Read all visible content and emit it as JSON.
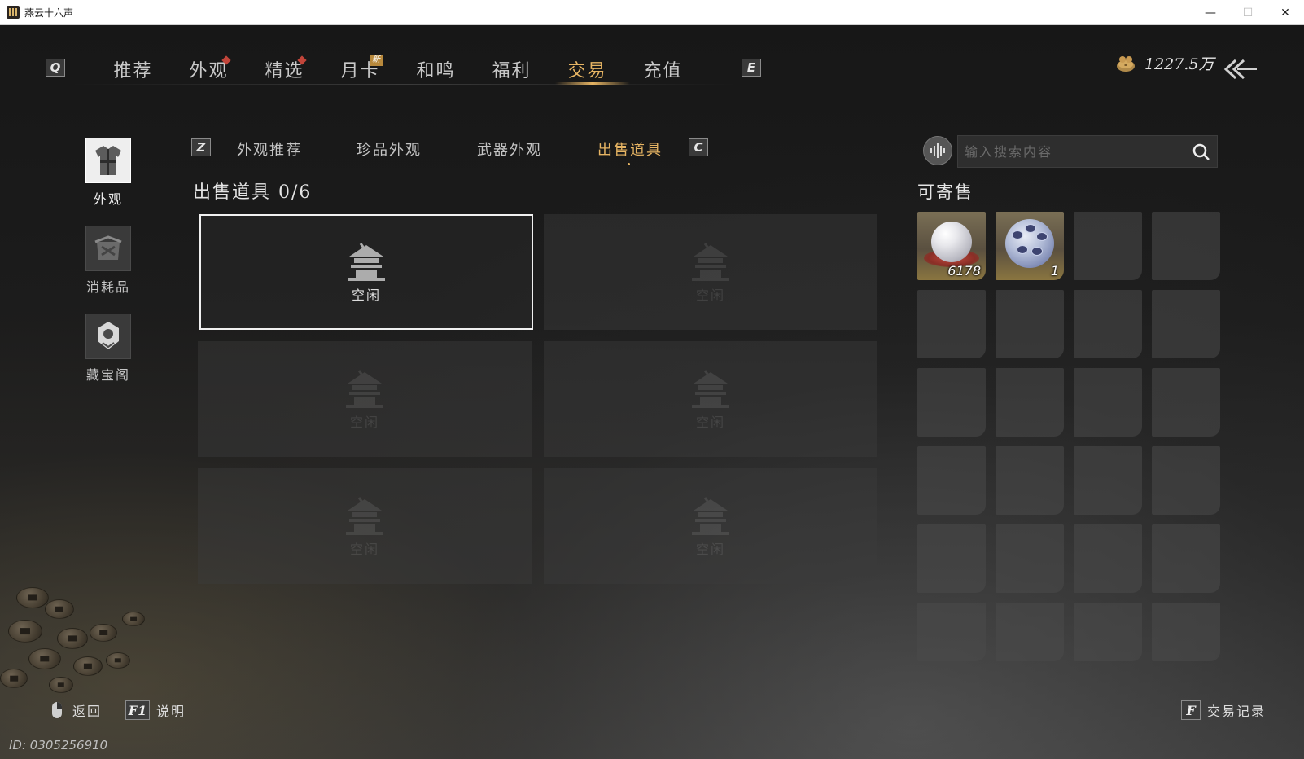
{
  "window": {
    "title": "燕云十六声",
    "minimize": "—",
    "maximize": "☐",
    "close": "✕"
  },
  "top_nav": {
    "left_key": "Q",
    "right_key": "E",
    "tabs": [
      {
        "label": "推荐",
        "badge": ""
      },
      {
        "label": "外观",
        "badge": "dot"
      },
      {
        "label": "精选",
        "badge": "dot"
      },
      {
        "label": "月卡",
        "badge": "新"
      },
      {
        "label": "和鸣",
        "badge": ""
      },
      {
        "label": "福利",
        "badge": ""
      },
      {
        "label": "交易",
        "badge": "",
        "active": true
      },
      {
        "label": "充值",
        "badge": ""
      }
    ],
    "currency_value": "1227.5万",
    "currency_icon": "coin-pouch-icon",
    "back_icon": "back-arrow-icon"
  },
  "sidebar": {
    "items": [
      {
        "label": "外观",
        "icon": "robe-icon",
        "active": true
      },
      {
        "label": "消耗品",
        "icon": "package-icon"
      },
      {
        "label": "藏宝阁",
        "icon": "treasure-pavilion-icon"
      }
    ]
  },
  "sub_tabs": {
    "left_key": "Z",
    "right_key": "C",
    "tabs": [
      {
        "label": "外观推荐"
      },
      {
        "label": "珍品外观"
      },
      {
        "label": "武器外观"
      },
      {
        "label": "出售道具",
        "active": true
      }
    ]
  },
  "sell": {
    "title": "出售道具 0/6",
    "slots": [
      {
        "label": "空闲",
        "selected": true
      },
      {
        "label": "空闲"
      },
      {
        "label": "空闲"
      },
      {
        "label": "空闲"
      },
      {
        "label": "空闲"
      },
      {
        "label": "空闲"
      }
    ]
  },
  "search": {
    "placeholder": "输入搜索内容",
    "value": ""
  },
  "consignable": {
    "title": "可寄售",
    "items": [
      {
        "icon": "pearl-icon",
        "qty": "6178"
      },
      {
        "icon": "crystal-orb-icon",
        "qty": "1"
      }
    ]
  },
  "bottom": {
    "back_label": "返回",
    "help_key": "F1",
    "help_label": "说明",
    "records_key": "F",
    "records_label": "交易记录",
    "user_id": "ID: 0305256910"
  },
  "colors": {
    "accent": "#e6b463",
    "badge_red": "#c2453a"
  }
}
